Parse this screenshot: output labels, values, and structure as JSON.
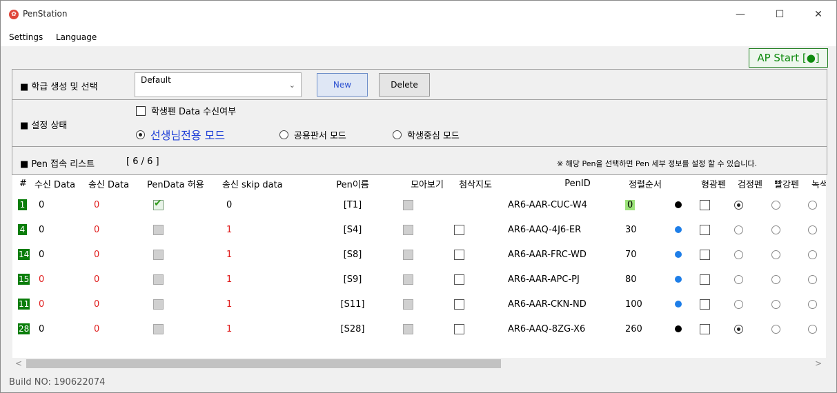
{
  "window": {
    "title": "PenStation",
    "minimize": "—",
    "maximize": "☐",
    "close": "✕"
  },
  "menu": [
    "Settings",
    "Language"
  ],
  "ap_button": "AP Start [●]",
  "class_section": {
    "label": "■ 학급 생성 및 선택",
    "combo_value": "Default",
    "new_label": "New",
    "delete_label": "Delete"
  },
  "settings_section": {
    "label": "■ 설정 상태",
    "receive_checkbox": "학생펜 Data 수신여부",
    "modes": [
      "선생님전용 모드",
      "공용판서 모드",
      "학생중심 모드"
    ],
    "selected_mode": 0
  },
  "pen_list": {
    "label": "■ Pen 접속 리스트",
    "count": "[ 6 / 6 ]",
    "hint": "※ 해당 Pen을 선택하면 Pen 세부 정보를 설정 할 수 있습니다."
  },
  "headers": [
    "#",
    "수신 Data",
    "송신 Data",
    "PenData 허용",
    "송신 skip data",
    "Pen이름",
    "모아보기",
    "첨삭지도",
    "PenID",
    "정렬순서",
    "",
    "형광펜",
    "검정펜",
    "빨강펜",
    "녹색"
  ],
  "rows": [
    {
      "num": "1",
      "recv": "0",
      "recv_red": false,
      "send": "0",
      "pendata": "check",
      "skip": "0",
      "skip_red": false,
      "name": "[T1]",
      "edit": false,
      "penid": "AR6-AAR-CUC-W4",
      "order": "0",
      "order_hl": true,
      "dot": "#000000",
      "black": true
    },
    {
      "num": "4",
      "recv": "0",
      "recv_red": false,
      "send": "0",
      "pendata": "gray",
      "skip": "1",
      "skip_red": true,
      "name": "[S4]",
      "edit": true,
      "penid": "AR6-AAQ-4J6-ER",
      "order": "30",
      "order_hl": false,
      "dot": "#1e7ee8",
      "black": false
    },
    {
      "num": "14",
      "recv": "0",
      "recv_red": false,
      "send": "0",
      "pendata": "gray",
      "skip": "1",
      "skip_red": true,
      "name": "[S8]",
      "edit": true,
      "penid": "AR6-AAR-FRC-WD",
      "order": "70",
      "order_hl": false,
      "dot": "#1e7ee8",
      "black": false
    },
    {
      "num": "15",
      "recv": "0",
      "recv_red": true,
      "send": "0",
      "pendata": "gray",
      "skip": "1",
      "skip_red": true,
      "name": "[S9]",
      "edit": true,
      "penid": "AR6-AAR-APC-PJ",
      "order": "80",
      "order_hl": false,
      "dot": "#1e7ee8",
      "black": false
    },
    {
      "num": "11",
      "recv": "0",
      "recv_red": true,
      "send": "0",
      "pendata": "gray",
      "skip": "1",
      "skip_red": true,
      "name": "[S11]",
      "edit": true,
      "penid": "AR6-AAR-CKN-ND",
      "order": "100",
      "order_hl": false,
      "dot": "#1e7ee8",
      "black": false
    },
    {
      "num": "28",
      "recv": "0",
      "recv_red": false,
      "send": "0",
      "pendata": "gray",
      "skip": "1",
      "skip_red": true,
      "name": "[S28]",
      "edit": true,
      "penid": "AR6-AAQ-8ZG-X6",
      "order": "260",
      "order_hl": false,
      "dot": "#000000",
      "black": true
    }
  ],
  "scroll": {
    "left": "<",
    "right": ">"
  },
  "build": "Build NO: 190622074"
}
